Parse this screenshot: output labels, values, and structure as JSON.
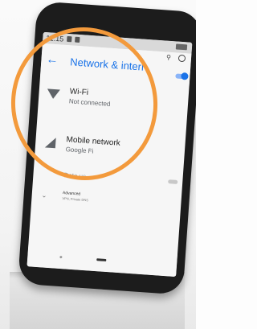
{
  "status_bar": {
    "time": "11:15"
  },
  "app_bar": {
    "back_icon": "arrow-left-icon",
    "title": "Network & intern"
  },
  "rows": [
    {
      "icon": "wifi-icon",
      "title": "Wi-Fi",
      "subtitle": "Not connected"
    },
    {
      "icon": "cellular-icon",
      "title": "Mobile network",
      "subtitle": "Google Fi"
    }
  ],
  "partial_row": {
    "title": "Data us"
  },
  "advanced": {
    "title": "Advanced",
    "subtitle": "VPN, Private DNS"
  },
  "colors": {
    "accent": "#1a73e8",
    "annotation_circle": "#f39a3c",
    "phone_body": "#1c1c1c"
  }
}
